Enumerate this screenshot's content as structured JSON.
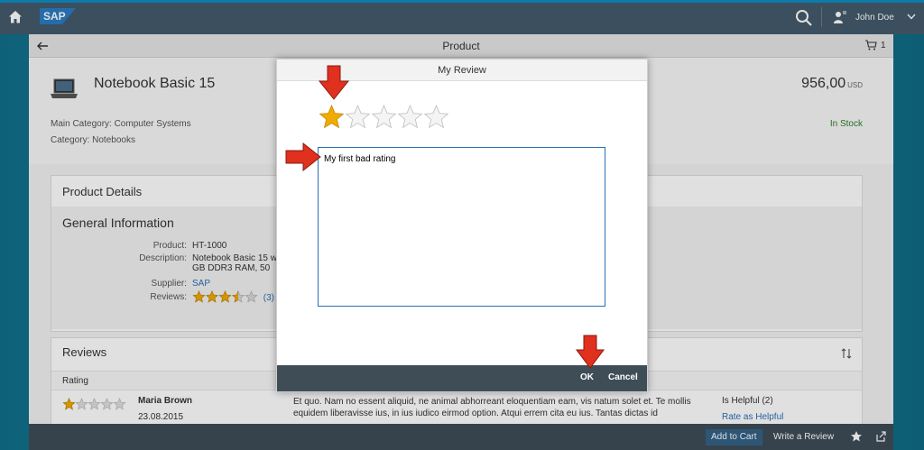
{
  "shell": {
    "logo": "SAP",
    "user_name": "John Doe"
  },
  "app": {
    "title": "Product",
    "cart_count": "1"
  },
  "product": {
    "name": "Notebook Basic 15",
    "price": "956,00",
    "currency": "USD",
    "main_category": "Main Category: Computer Systems",
    "category": "Category: Notebooks",
    "availability": "In Stock"
  },
  "details": {
    "section_title": "Product Details",
    "panel_title": "General Information",
    "fields": {
      "product_label": "Product:",
      "product_value": "HT-1000",
      "description_label": "Description:",
      "description_line1": "Notebook Basic 15 w",
      "description_line2": "GB DDR3 RAM, 50",
      "supplier_label": "Supplier:",
      "supplier_value": "SAP",
      "reviews_label": "Reviews:",
      "reviews_count": "(3)",
      "reviews_rating": 3.5
    }
  },
  "reviews": {
    "section_title": "Reviews",
    "column_rating": "Rating",
    "items": [
      {
        "name": "Maria Brown",
        "date": "23.08.2015",
        "rating": 1,
        "text": "Et quo. Nam no essent aliquid, ne animal abhorreant eloquentiam eam, vis natum solet et. Te mollis equidem liberavisse ius, in ius iudico eirmod option. Atqui errem cita eu ius. Tantas dictas id",
        "helpful": "Is Helpful (2)",
        "rate_link": "Rate as Helpful"
      }
    ]
  },
  "footer": {
    "add_to_cart": "Add to Cart",
    "write_review": "Write a Review"
  },
  "dialog": {
    "title": "My Review",
    "rating": 1,
    "max_rating": 5,
    "text": "My first bad rating",
    "ok": "OK",
    "cancel": "Cancel"
  },
  "colors": {
    "shell_header": "#445b6b",
    "shell_accent": "#0f8dc1",
    "star_filled": "#f0ab00",
    "star_empty": "#e5e5e5",
    "arrow": "#e0301e",
    "footer": "#3f4d57",
    "link": "#2a6fb5",
    "in_stock": "#2b7d2b"
  },
  "icons": [
    "home-icon",
    "search-icon",
    "user-icon",
    "chevron-down-icon",
    "back-arrow-icon",
    "cart-icon",
    "laptop-icon",
    "sort-icon",
    "favorite-star-icon",
    "share-icon",
    "red-pointer-arrow"
  ]
}
